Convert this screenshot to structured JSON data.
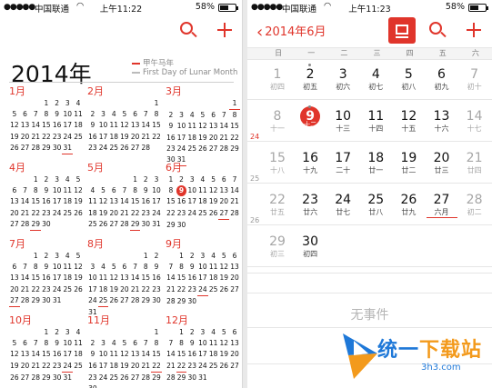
{
  "status_left": {
    "carrier": "中国联通",
    "time": "上午11:22",
    "battery": "58%"
  },
  "status_right": {
    "carrier": "中国联通",
    "time": "上午11:23",
    "battery": "58%"
  },
  "year_view": {
    "year_title": "2014年",
    "legend": [
      {
        "color": "#e0352b",
        "text": "甲午马年"
      },
      {
        "color": "#bbbbbb",
        "text": "First Day of Lunar Month"
      }
    ],
    "months": [
      {
        "name": "1月",
        "start": 3,
        "days": 31,
        "lunar": [
          31
        ],
        "today": null
      },
      {
        "name": "2月",
        "start": 6,
        "days": 28,
        "lunar": [],
        "today": null
      },
      {
        "name": "3月",
        "start": 6,
        "days": 31,
        "lunar": [
          1,
          31
        ],
        "today": null
      },
      {
        "name": "4月",
        "start": 2,
        "days": 30,
        "lunar": [
          29
        ],
        "today": null
      },
      {
        "name": "5月",
        "start": 4,
        "days": 31,
        "lunar": [
          29
        ],
        "today": null
      },
      {
        "name": "6月",
        "start": 0,
        "days": 30,
        "lunar": [
          27
        ],
        "today": 9
      },
      {
        "name": "7月",
        "start": 2,
        "days": 31,
        "lunar": [
          27
        ],
        "today": null
      },
      {
        "name": "8月",
        "start": 5,
        "days": 31,
        "lunar": [
          25
        ],
        "today": null
      },
      {
        "name": "9月",
        "start": 1,
        "days": 30,
        "lunar": [
          24
        ],
        "today": null
      },
      {
        "name": "10月",
        "start": 3,
        "days": 31,
        "lunar": [
          24
        ],
        "today": null
      },
      {
        "name": "11月",
        "start": 6,
        "days": 30,
        "lunar": [
          22
        ],
        "today": null
      },
      {
        "name": "12月",
        "start": 1,
        "days": 31,
        "lunar": [
          22
        ],
        "today": null
      }
    ]
  },
  "month_view": {
    "back_label": "2014年6月",
    "weekdays": [
      "日",
      "一",
      "二",
      "三",
      "四",
      "五",
      "六"
    ],
    "weeks": [
      {
        "num": "",
        "days": [
          [
            "1",
            "初四"
          ],
          [
            "2",
            "初五"
          ],
          [
            "3",
            "初六"
          ],
          [
            "4",
            "初七"
          ],
          [
            "5",
            "初八"
          ],
          [
            "6",
            "初九"
          ],
          [
            "7",
            "初十"
          ]
        ]
      },
      {
        "num": "24",
        "days": [
          [
            "8",
            "十一"
          ],
          [
            "9",
            "十二"
          ],
          [
            "10",
            "十三"
          ],
          [
            "11",
            "十四"
          ],
          [
            "12",
            "十五"
          ],
          [
            "13",
            "十六"
          ],
          [
            "14",
            "十七"
          ]
        ]
      },
      {
        "num": "25",
        "days": [
          [
            "15",
            "十八"
          ],
          [
            "16",
            "十九"
          ],
          [
            "17",
            "二十"
          ],
          [
            "18",
            "廿一"
          ],
          [
            "19",
            "廿二"
          ],
          [
            "20",
            "廿三"
          ],
          [
            "21",
            "廿四"
          ]
        ]
      },
      {
        "num": "26",
        "days": [
          [
            "22",
            "廿五"
          ],
          [
            "23",
            "廿六"
          ],
          [
            "24",
            "廿七"
          ],
          [
            "25",
            "廿八"
          ],
          [
            "26",
            "廿九"
          ],
          [
            "27",
            "六月"
          ],
          [
            "28",
            "初二"
          ]
        ]
      },
      {
        "num": "",
        "days": [
          [
            "29",
            "初三"
          ],
          [
            "30",
            "初四"
          ]
        ]
      }
    ],
    "no_events": "无事件"
  },
  "watermark": {
    "text_a": "统一",
    "text_b": "下载站",
    "sub": "3h3.com"
  }
}
